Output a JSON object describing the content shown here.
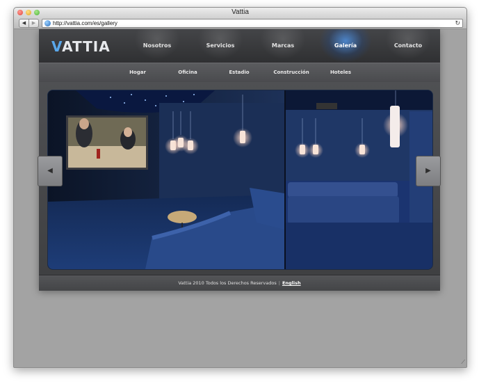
{
  "window": {
    "title": "Vattia",
    "url": "http://vattia.com/es/gallery"
  },
  "site": {
    "logo": {
      "prefix": "V",
      "rest": "ATTIA"
    },
    "nav": [
      {
        "label": "Nosotros"
      },
      {
        "label": "Servicios"
      },
      {
        "label": "Marcas"
      },
      {
        "label": "Galería",
        "active": true
      },
      {
        "label": "Contacto"
      }
    ],
    "subnav": [
      {
        "label": "Hogar"
      },
      {
        "label": "Oficina"
      },
      {
        "label": "Estadio"
      },
      {
        "label": "Construcción"
      },
      {
        "label": "Hoteles"
      }
    ],
    "gallery": {
      "prev": "◀",
      "next": "▶"
    },
    "footer": {
      "copyright": "Vattia 2010 Todos los Derechos Reservados",
      "separator": "|",
      "language_link": "English"
    }
  },
  "colors": {
    "accent": "#4f96e6",
    "site_bg": "#3c3d3f",
    "page_bg": "#a3a3a3"
  }
}
